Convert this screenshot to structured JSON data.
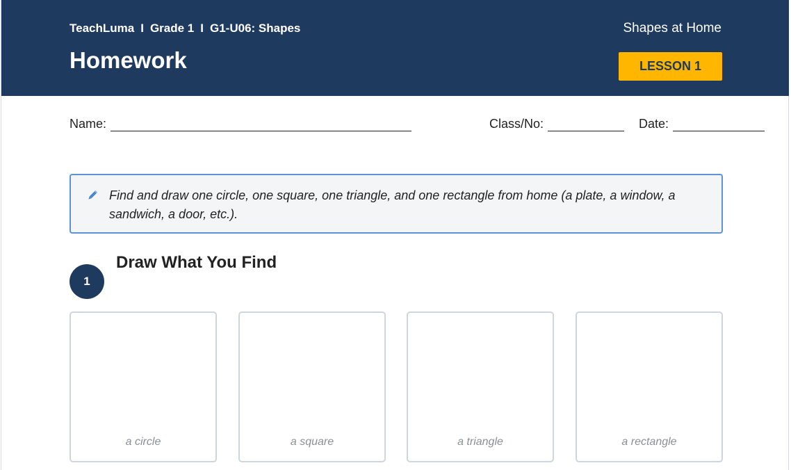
{
  "header": {
    "breadcrumb": [
      "TeachLuma",
      "Grade 1",
      "G1-U06: Shapes"
    ],
    "separator": "I",
    "title": "Homework",
    "topic": "Shapes at Home",
    "lesson_label": "LESSON 1",
    "colors": {
      "background": "#1f3a5f",
      "badge": "#ffb600"
    }
  },
  "fields": {
    "name_label": "Name:",
    "class_label": "Class/No:",
    "date_label": "Date:"
  },
  "instructions": {
    "icon": "pencil-icon",
    "text": "Find and draw one circle, one square, one triangle, and one rectangle from home (a plate, a window, a sandwich, a door, etc.)."
  },
  "section": {
    "number": "1",
    "title": "Draw What You Find",
    "boxes": [
      {
        "label": "a circle"
      },
      {
        "label": "a square"
      },
      {
        "label": "a triangle"
      },
      {
        "label": "a rectangle"
      }
    ]
  }
}
